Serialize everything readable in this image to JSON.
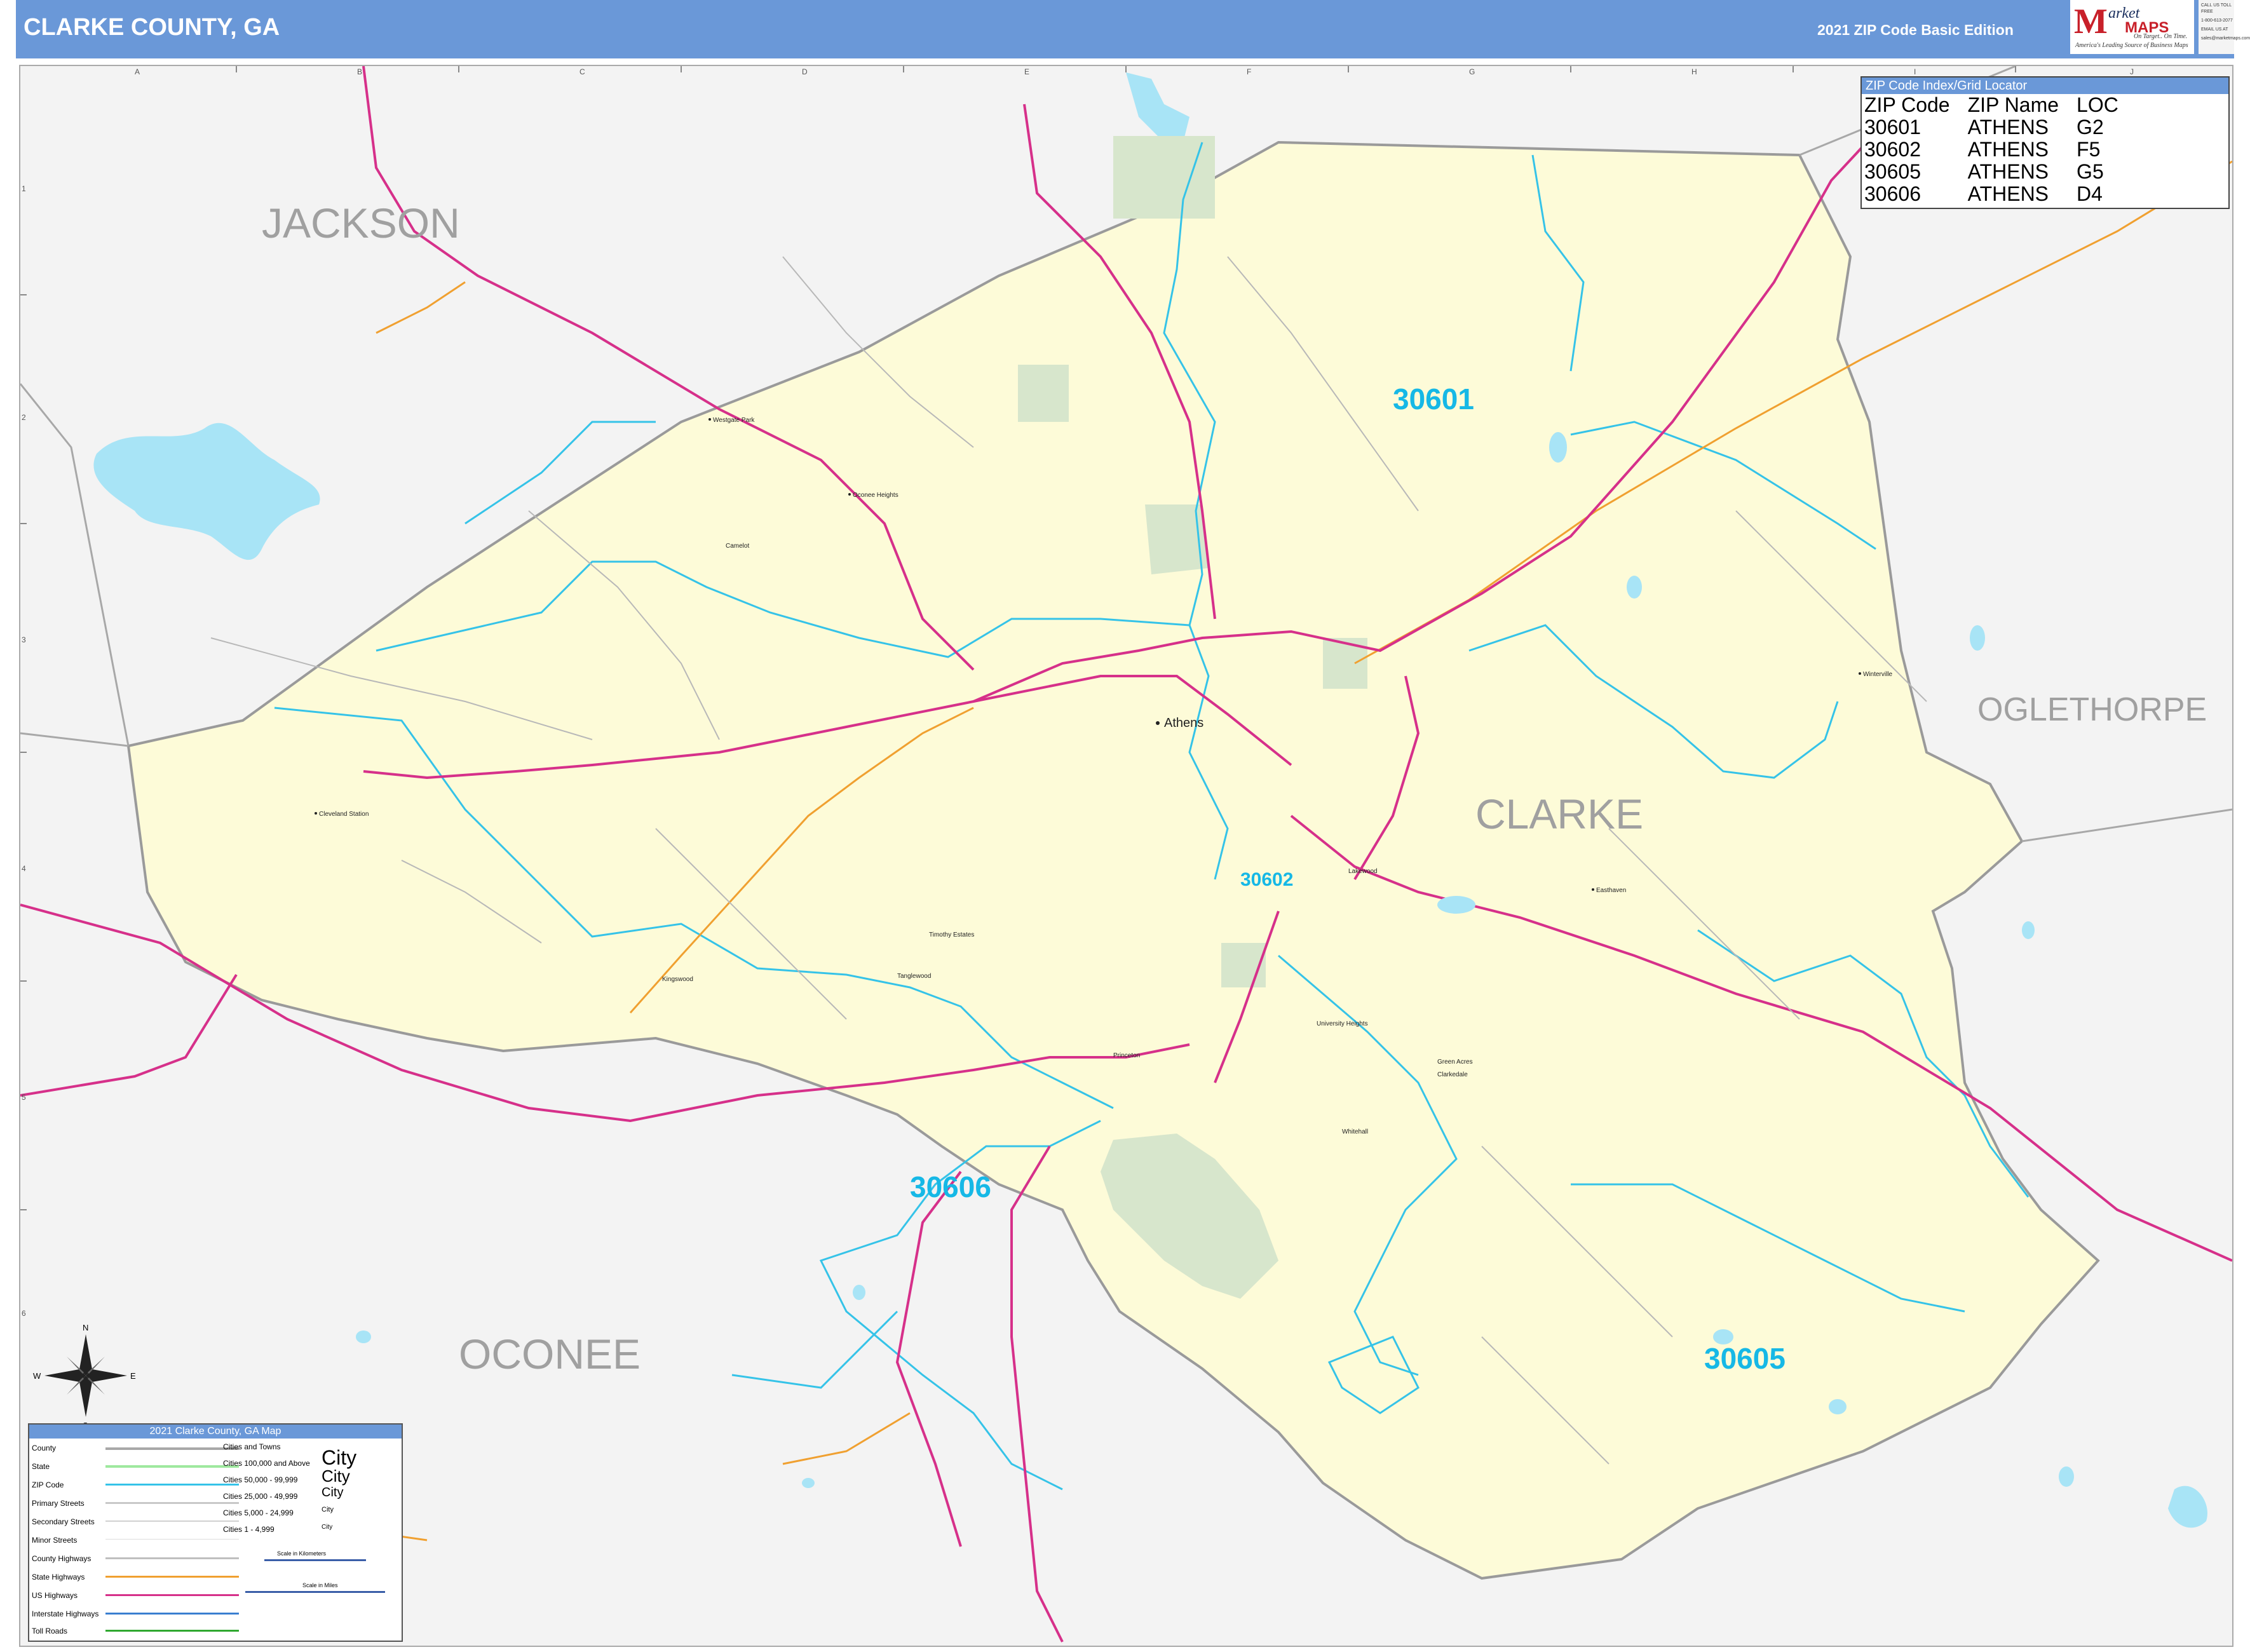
{
  "header": {
    "title": "CLARKE COUNTY, GA",
    "edition": "2021 ZIP Code Basic Edition",
    "logo_text1": "arket",
    "logo_text2": "MAPS",
    "logo_slogan": "America's Leading Source of Business Maps",
    "logo_tagline": "On Target.. On Time.",
    "contact": [
      "CALL US TOLL FREE",
      "1-800-613-2077",
      "EMAIL US AT",
      "sales@marketmaps.com"
    ]
  },
  "grid": {
    "columns": [
      "A",
      "B",
      "C",
      "D",
      "E",
      "F",
      "G",
      "H",
      "I",
      "J"
    ],
    "rows": [
      "1",
      "2",
      "3",
      "4",
      "5",
      "6"
    ]
  },
  "counties": {
    "jackson": "JACKSON",
    "clarke": "CLARKE",
    "oglethorpe": "OGLETHORPE",
    "oconee": "OCONEE"
  },
  "zip_labels": {
    "z30601": "30601",
    "z30602": "30602",
    "z30605": "30605",
    "z30606": "30606"
  },
  "cities": {
    "athens": "Athens",
    "westgate_park": "Westgate Park",
    "oconee_heights": "Oconee Heights",
    "camelot": "Camelot",
    "cleveland_station": "Cleveland Station",
    "kingswood": "Kingswood",
    "timothy_estates": "Timothy Estates",
    "tanglewood": "Tanglewood",
    "princeton": "Princeton",
    "lakewood": "Lakewood",
    "university_heights": "University Heights",
    "green_acres": "Green Acres",
    "clarkedale": "Clarkedale",
    "whitehall": "Whitehall",
    "easthaven": "Easthaven",
    "winterville": "Winterville"
  },
  "zip_index": {
    "title": "ZIP Code Index/Grid Locator",
    "columns": [
      "ZIP Code",
      "ZIP Name",
      "LOC"
    ],
    "rows": [
      [
        "30601",
        "ATHENS",
        "G2"
      ],
      [
        "30602",
        "ATHENS",
        "F5"
      ],
      [
        "30605",
        "ATHENS",
        "G5"
      ],
      [
        "30606",
        "ATHENS",
        "D4"
      ]
    ]
  },
  "legend": {
    "title": "2021 Clarke County, GA Map",
    "line_items": [
      "County",
      "State",
      "ZIP Code",
      "Primary Streets",
      "Secondary Streets",
      "Minor Streets",
      "County Highways",
      "State Highways",
      "US Highways",
      "Interstate Highways",
      "Toll Roads"
    ],
    "cities_header": "Cities and Towns",
    "city_classes": [
      "Cities 100,000 and Above",
      "Cities 50,000 - 99,999",
      "Cities 25,000 - 49,999",
      "Cities 5,000 - 24,999",
      "Cities 1 - 4,999"
    ],
    "city_sample": "City",
    "scale_km": "Scale in Kilometers",
    "scale_mi": "Scale in Miles"
  },
  "compass": {
    "n": "N",
    "s": "S",
    "e": "E",
    "w": "W"
  },
  "colors": {
    "header": "#6a98d8",
    "county_fill": "#fdfbd8",
    "outside_fill": "#f3f3f3",
    "zip_line": "#35c3e8",
    "zip_label": "#16b8e6",
    "us_highway": "#d6308a",
    "state_highway": "#f0a030",
    "water": "#a8e4f6",
    "park": "#d7e6cc",
    "county_label": "#a0a0a0"
  }
}
